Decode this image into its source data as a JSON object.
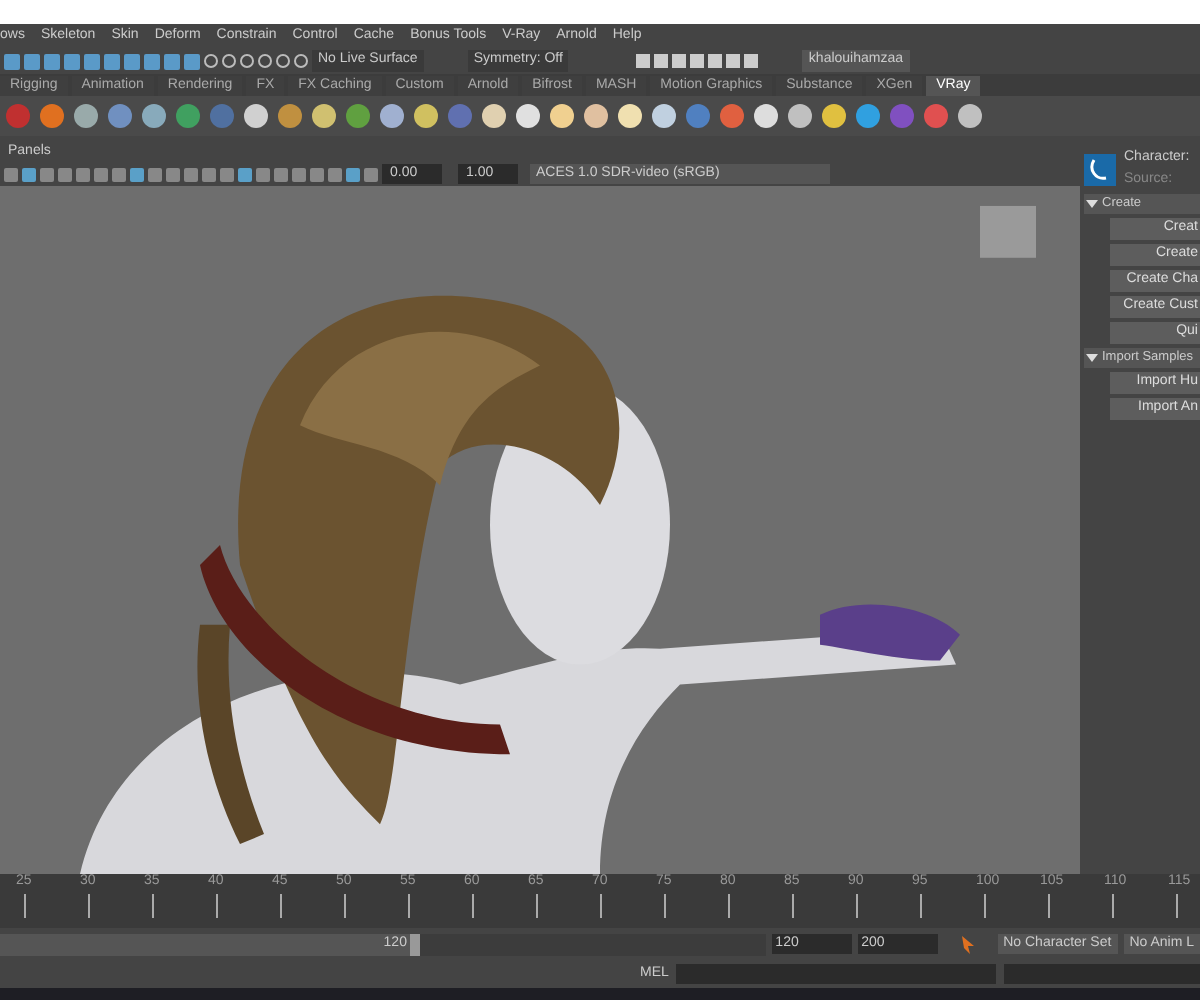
{
  "menu": [
    "ows",
    "Skeleton",
    "Skin",
    "Deform",
    "Constrain",
    "Control",
    "Cache",
    "Bonus Tools",
    "V-Ray",
    "Arnold",
    "Help"
  ],
  "status_line": {
    "live_surface": "No Live Surface",
    "symmetry": "Symmetry: Off",
    "user": "khalouihamzaa"
  },
  "shelf_tabs": [
    {
      "label": "Rigging",
      "selected": false
    },
    {
      "label": "Animation",
      "selected": false
    },
    {
      "label": "Rendering",
      "selected": false
    },
    {
      "label": "FX",
      "selected": false
    },
    {
      "label": "FX Caching",
      "selected": false
    },
    {
      "label": "Custom",
      "selected": false
    },
    {
      "label": "Arnold",
      "selected": false
    },
    {
      "label": "Bifrost",
      "selected": false
    },
    {
      "label": "MASH",
      "selected": false
    },
    {
      "label": "Motion Graphics",
      "selected": false
    },
    {
      "label": "Substance",
      "selected": false
    },
    {
      "label": "XGen",
      "selected": false
    },
    {
      "label": "VRay",
      "selected": true
    }
  ],
  "panel_menu": "Panels",
  "viewport_toolbar": {
    "exposure": "0.00",
    "gamma": "1.00",
    "color_space": "ACES 1.0 SDR-video (sRGB)"
  },
  "character_panel": {
    "character_label": "Character:",
    "source_label": "Source:",
    "sections": [
      {
        "title": "Create",
        "expanded": true,
        "buttons": [
          "Creat",
          "Create",
          "Create Cha",
          "Create Cust",
          "Qui"
        ]
      },
      {
        "title": "Import Samples",
        "expanded": true,
        "buttons": [
          "Import Hu",
          "Import An"
        ]
      }
    ]
  },
  "timeline": {
    "ticks": [
      "25",
      "30",
      "35",
      "40",
      "45",
      "50",
      "55",
      "60",
      "65",
      "70",
      "75",
      "80",
      "85",
      "90",
      "95",
      "100",
      "105",
      "110",
      "115"
    ]
  },
  "range": {
    "slider_end": "120",
    "level": 0.55,
    "end": "120",
    "max_end": "200",
    "character_set": "No Character Set",
    "anim_layer": "No Anim L"
  },
  "command_line": {
    "language": "MEL"
  }
}
